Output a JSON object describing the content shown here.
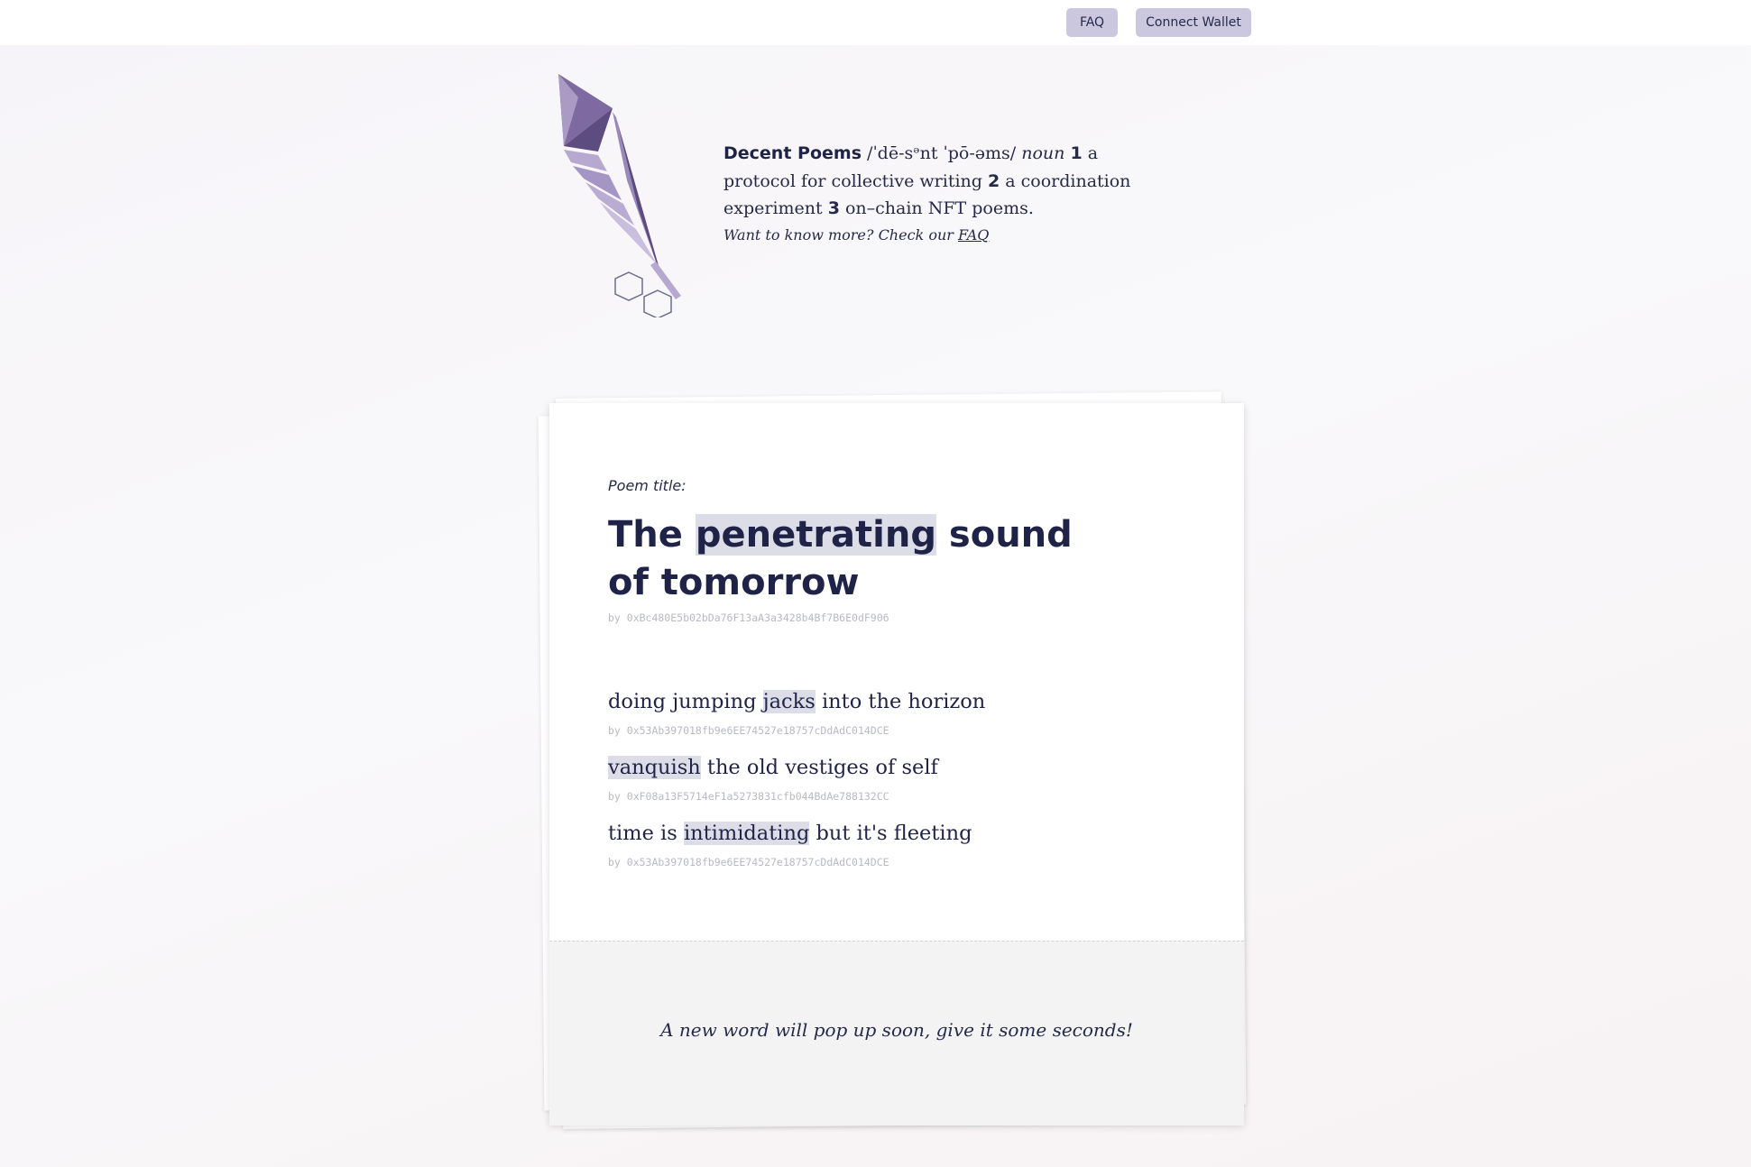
{
  "nav": {
    "faq_label": "FAQ",
    "wallet_label": "Connect Wallet"
  },
  "logo": {
    "icon": "quill-feather-icon",
    "colors": [
      "#7e6aa0",
      "#5c4c80",
      "#b7a8d0",
      "#9989b8"
    ]
  },
  "definition": {
    "brand": "Decent Poems",
    "pronunciation": " /ˈdē-sᵊnt ˈpō-əms/ ",
    "pos": "noun",
    "n1": "1",
    "def1": " a protocol for collective writing ",
    "n2": "2",
    "def2": " a coordination experiment ",
    "n3": "3",
    "def3": " on–chain NFT poems.",
    "more_text": "Want to know more? Check our ",
    "more_link": "FAQ"
  },
  "poem": {
    "title_label": "Poem title:",
    "title_before": "The ",
    "title_highlight": "penetrating",
    "title_after": " sound of tomorrow",
    "title_author": "by 0xBc480E5b02bDa76F13aA3a3428b4Bf7B6E0dF906",
    "verses": [
      {
        "before": "doing jumping ",
        "highlight": "jacks",
        "after": " into the horizon",
        "author": "by 0x53Ab397018fb9e6EE74527e18757cDdAdC014DCE"
      },
      {
        "before": "",
        "highlight": "vanquish",
        "after": " the old vestiges of self",
        "author": "by 0xF08a13F5714eF1a5273831cfb044BdAe788132CC"
      },
      {
        "before": "time is ",
        "highlight": "intimidating",
        "after": " but it's fleeting",
        "author": "by 0x53Ab397018fb9e6EE74527e18757cDdAdC014DCE"
      }
    ],
    "footer_message": "A new word will pop up soon, give it some seconds!"
  },
  "colors": {
    "text": "#1f2347",
    "button_bg": "#cbc7df",
    "highlight_bg": "#dcdde6",
    "address": "#b8b9c4"
  }
}
